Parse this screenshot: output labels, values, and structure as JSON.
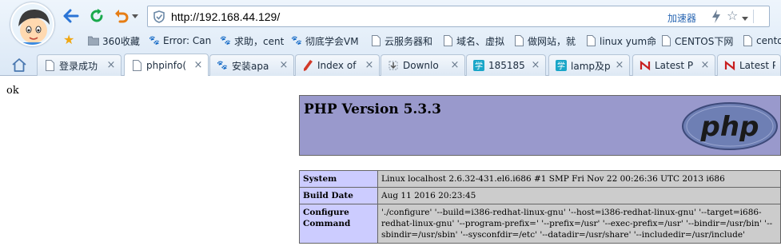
{
  "browser": {
    "address_url": "http://192.168.44.129/",
    "accelerator_label": "加速器",
    "icons": {
      "back": "back-arrow-icon",
      "refresh": "refresh-icon",
      "undo": "undo-icon",
      "shield": "shield-icon",
      "lightning": "lightning-icon",
      "star": "star-icon",
      "home": "home-icon"
    },
    "colors": {
      "nav_blue": "#2a74d6",
      "refresh_green": "#1aa94c",
      "undo_orange": "#e67d14"
    }
  },
  "bookmarks": [
    {
      "label": "360收藏",
      "icon": "folder-icon"
    },
    {
      "label": "Error: Can",
      "icon": "paw-icon"
    },
    {
      "label": "求助，cent",
      "icon": "paw-icon"
    },
    {
      "label": "彻底学会VM",
      "icon": "paw-icon"
    },
    {
      "label": "云服务器和",
      "icon": "page-icon"
    },
    {
      "label": "域名、虚拟",
      "icon": "page-icon"
    },
    {
      "label": "做网站，就",
      "icon": "page-icon"
    },
    {
      "label": "linux yum命",
      "icon": "page-icon"
    },
    {
      "label": "CENTOS下网",
      "icon": "page-icon"
    },
    {
      "label": "cento",
      "icon": "page-icon"
    }
  ],
  "tabs": [
    {
      "label": "登录成功",
      "icon": "page-icon"
    },
    {
      "label": "phpinfo(",
      "icon": "page-icon",
      "active": true
    },
    {
      "label": "安装apa",
      "icon": "paw-icon"
    },
    {
      "label": "Index of",
      "icon": "pen-icon"
    },
    {
      "label": "Downlo",
      "icon": "download-icon"
    },
    {
      "label": "185185",
      "icon": "xue-icon"
    },
    {
      "label": "lamp及p",
      "icon": "xue-icon"
    },
    {
      "label": "Latest P",
      "icon": "red-n-icon"
    },
    {
      "label": "Latest P",
      "icon": "red-n-icon"
    }
  ],
  "page": {
    "ok_text": "ok",
    "php_version_title": "PHP Version 5.3.3",
    "php_logo_text": "php",
    "info_rows": [
      {
        "key": "System",
        "value": "Linux localhost 2.6.32-431.el6.i686 #1 SMP Fri Nov 22 00:26:36 UTC 2013 i686"
      },
      {
        "key": "Build Date",
        "value": "Aug 11 2016 20:23:45"
      },
      {
        "key": "Configure Command",
        "value": "'./configure' '--build=i386-redhat-linux-gnu' '--host=i386-redhat-linux-gnu' '--target=i686-redhat-linux-gnu' '--program-prefix=' '--prefix=/usr' '--exec-prefix=/usr' '--bindir=/usr/bin' '--sbindir=/usr/sbin' '--sysconfdir=/etc' '--datadir=/usr/share' '--includedir=/usr/include'"
      }
    ],
    "colors": {
      "header_bg": "#9999cc",
      "key_bg": "#ccccff",
      "value_bg": "#cccccc",
      "logo_bg": "#6e7fb4"
    }
  }
}
